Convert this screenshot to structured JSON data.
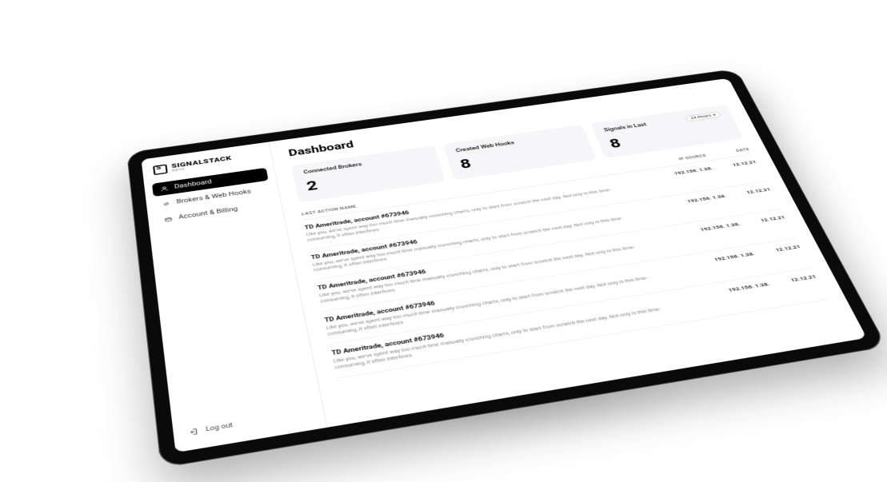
{
  "brand": {
    "name": "SIGNALSTACK",
    "tag": "BETA"
  },
  "sidebar": {
    "items": [
      {
        "label": "Dashboard",
        "active": true
      },
      {
        "label": "Brokers & Web Hooks",
        "active": false
      },
      {
        "label": "Account & Billing",
        "active": false
      }
    ],
    "logout": "Log out"
  },
  "page": {
    "title": "Dashboard"
  },
  "cards": [
    {
      "label": "Connected Brokers",
      "value": "2"
    },
    {
      "label": "Created Web Hooks",
      "value": "8"
    },
    {
      "label": "Signals in Last",
      "value": "8",
      "filter": "24 Hours"
    }
  ],
  "table": {
    "columns": {
      "name": "LAST ACTION NAME",
      "ip": "IP SOURCE",
      "date": "DATE"
    },
    "rows": [
      {
        "title": "TD Ameritrade, account #673946",
        "desc": "Like you, we've spent way too much time manually crunching charts, only to start from scratch the next day. Not only is this time-consuming, it often interferes",
        "ip": "192.156. 1.38.",
        "date": "12.12.21"
      },
      {
        "title": "TD Ameritrade, account #673946",
        "desc": "Like you, we've spent way too much time manually crunching charts, only to start from scratch the next day. Not only is this time-consuming, it often interferes",
        "ip": "192.156. 1.38.",
        "date": "12.12.21"
      },
      {
        "title": "TD Ameritrade, account #673946",
        "desc": "Like you, we've spent way too much time manually crunching charts, only to start from scratch the next day. Not only is this time-consuming, it often interferes",
        "ip": "192.156. 1.38.",
        "date": "12.12.21"
      },
      {
        "title": "TD Ameritrade, account #673946",
        "desc": "Like you, we've spent way too much time manually crunching charts, only to start from scratch the next day. Not only is this time-consuming, it often interferes",
        "ip": "192.156. 1.38.",
        "date": "12.12.21"
      },
      {
        "title": "TD Ameritrade, account #673946",
        "desc": "Like you, we've spent way too much time manually crunching charts, only to start from scratch the next day. Not only is this time-consuming, it often interferes",
        "ip": "192.156. 1.38.",
        "date": "12.12.21"
      }
    ]
  }
}
